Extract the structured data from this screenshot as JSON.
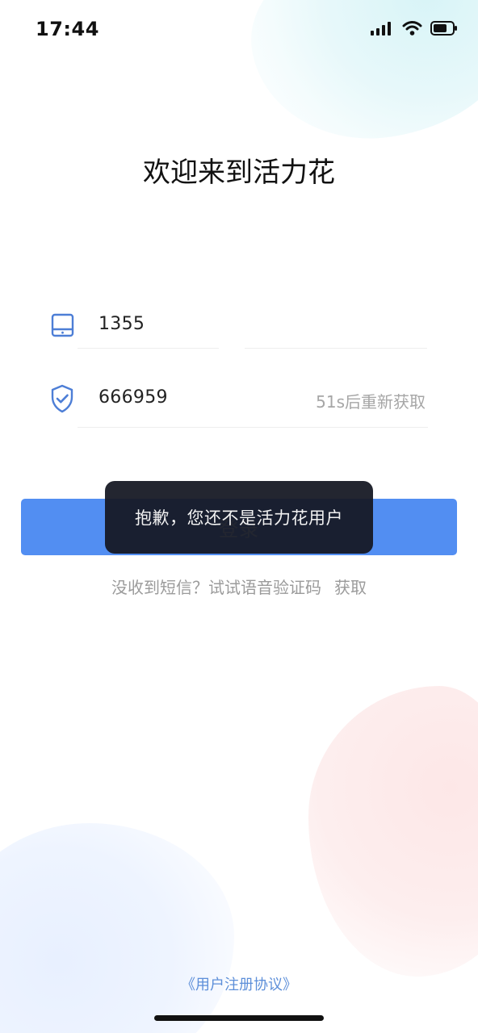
{
  "status_bar": {
    "time": "17:44",
    "icons": [
      "signal-icon",
      "wifi-icon",
      "battery-icon"
    ]
  },
  "welcome": {
    "title": "欢迎来到活力花"
  },
  "form": {
    "phone_value": "1355",
    "code_value": "666959",
    "resend_text": "51s后重新获取"
  },
  "actions": {
    "login_label": "登录",
    "voice_prompt": "没收到短信？试试语音验证码",
    "voice_fetch_label": "获取"
  },
  "toast": {
    "message": "抱歉，您还不是活力花用户"
  },
  "footer": {
    "agreement": "《用户注册协议》"
  },
  "colors": {
    "primary": "#528ef2",
    "link": "#5d8fd9",
    "toast_bg": "#151823"
  }
}
